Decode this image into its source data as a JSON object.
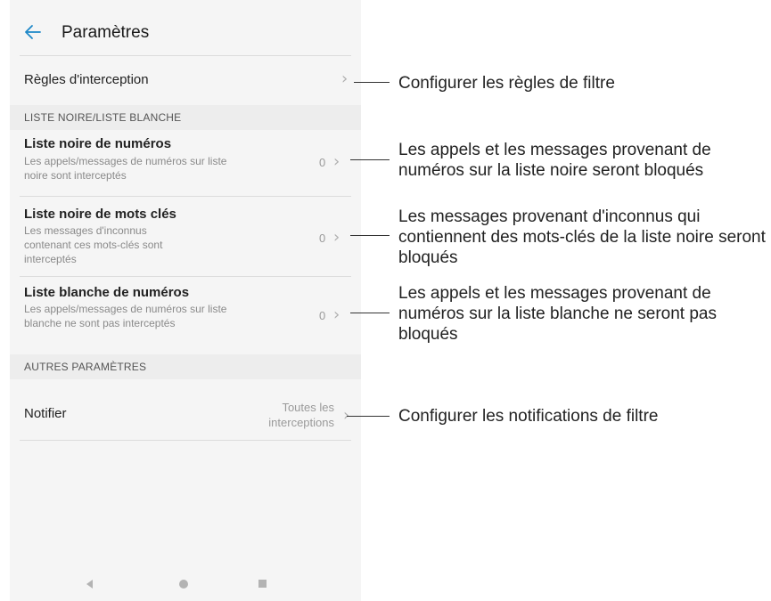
{
  "header": {
    "title": "Paramètres"
  },
  "rules": {
    "label": "Règles d'interception"
  },
  "section_blacklist": {
    "label": "LISTE NOIRE/LISTE BLANCHE"
  },
  "items": [
    {
      "title": "Liste noire de numéros",
      "desc": "Les appels/messages de numéros sur liste noire sont interceptés",
      "count": "0"
    },
    {
      "title": "Liste noire de mots clés",
      "desc": "Les messages d'inconnus contenant ces mots-clés sont interceptés",
      "count": "0"
    },
    {
      "title": "Liste blanche de numéros",
      "desc": "Les appels/messages de numéros sur liste blanche ne sont pas interceptés",
      "count": "0"
    }
  ],
  "section_other": {
    "label": "AUTRES PARAMÈTRES"
  },
  "notify": {
    "label": "Notifier",
    "value_line1": "Toutes les",
    "value_line2": "interceptions"
  },
  "annotations": {
    "rules": "Configurer les règles de filtre",
    "blacklist_numbers": "Les appels et les messages provenant de numéros sur la liste noire seront bloqués",
    "blacklist_keywords": "Les messages provenant d'inconnus qui contiennent des mots-clés de la liste noire seront bloqués",
    "whitelist_numbers": "Les appels et les messages provenant de numéros sur la liste blanche ne seront pas bloqués",
    "notify": "Configurer les notifications de filtre"
  },
  "icons": {
    "back": "arrow-left-icon",
    "chevron": "chevron-right-icon"
  },
  "colors": {
    "accent": "#1e88c8"
  }
}
